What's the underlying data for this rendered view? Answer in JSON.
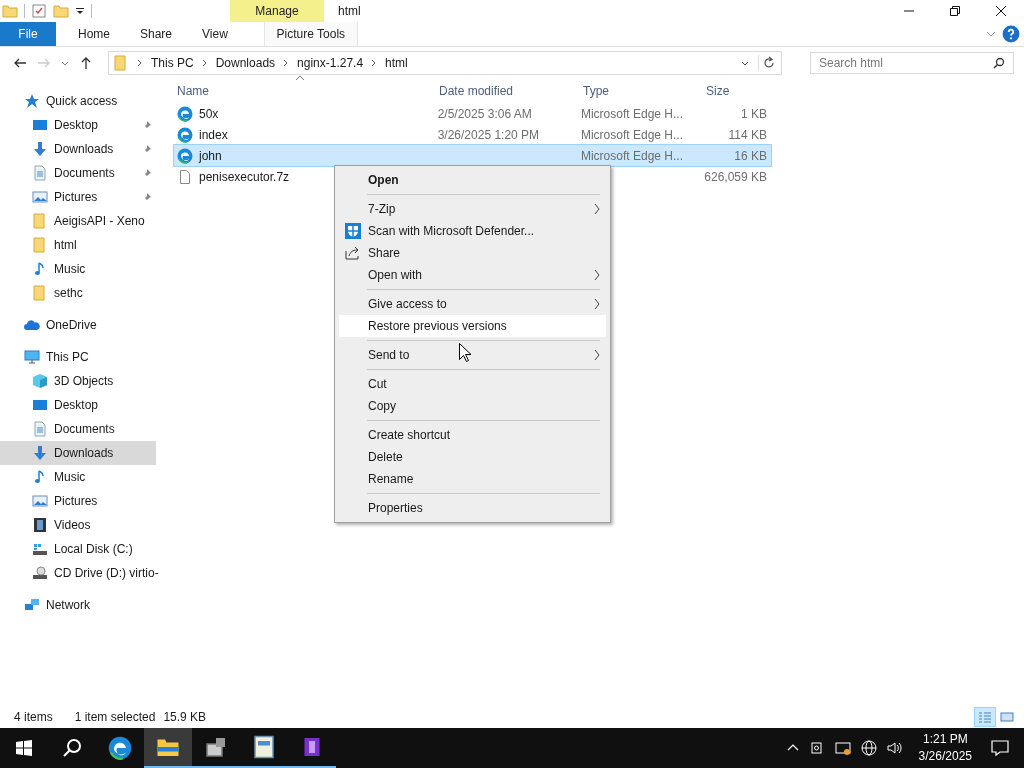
{
  "window": {
    "title": "html",
    "context_tab": "Manage"
  },
  "ribbon": {
    "tabs": [
      {
        "label": "File",
        "kind": "file",
        "selected": false
      },
      {
        "label": "Home",
        "kind": "tab",
        "selected": false
      },
      {
        "label": "Share",
        "kind": "tab",
        "selected": false
      },
      {
        "label": "View",
        "kind": "tab",
        "selected": false
      },
      {
        "label": "Picture Tools",
        "kind": "context",
        "selected": false
      }
    ]
  },
  "address": {
    "path": [
      "This PC",
      "Downloads",
      "nginx-1.27.4",
      "html"
    ],
    "forward_disabled": true
  },
  "search": {
    "placeholder": "Search html"
  },
  "nav": [
    {
      "label": "Quick access",
      "kind": "star",
      "selected": false,
      "children": [
        {
          "label": "Desktop",
          "kind": "desktop",
          "pinned": true,
          "selected": false
        },
        {
          "label": "Downloads",
          "kind": "downloads",
          "pinned": true,
          "selected": false
        },
        {
          "label": "Documents",
          "kind": "documents",
          "pinned": true,
          "selected": false
        },
        {
          "label": "Pictures",
          "kind": "pictures",
          "pinned": true,
          "selected": false
        },
        {
          "label": "AeigisAPI - Xeno",
          "kind": "folder",
          "pinned": false,
          "selected": false
        },
        {
          "label": "html",
          "kind": "folder",
          "pinned": false,
          "selected": false
        },
        {
          "label": "Music",
          "kind": "music",
          "pinned": false,
          "selected": false
        },
        {
          "label": "sethc",
          "kind": "folder",
          "pinned": false,
          "selected": false
        }
      ]
    },
    {
      "label": "OneDrive",
      "kind": "cloud",
      "selected": false
    },
    {
      "label": "This PC",
      "kind": "pc",
      "selected": false,
      "children": [
        {
          "label": "3D Objects",
          "kind": "objects",
          "selected": false
        },
        {
          "label": "Desktop",
          "kind": "desktop",
          "selected": false
        },
        {
          "label": "Documents",
          "kind": "documents",
          "selected": false
        },
        {
          "label": "Downloads",
          "kind": "downloads",
          "selected": true
        },
        {
          "label": "Music",
          "kind": "music",
          "selected": false
        },
        {
          "label": "Pictures",
          "kind": "pictures",
          "selected": false
        },
        {
          "label": "Videos",
          "kind": "videos",
          "selected": false
        },
        {
          "label": "Local Disk (C:)",
          "kind": "disk",
          "selected": false
        },
        {
          "label": "CD Drive (D:) virtio-",
          "kind": "cd",
          "selected": false
        }
      ]
    },
    {
      "label": "Network",
      "kind": "network",
      "selected": false
    }
  ],
  "table": {
    "columns": [
      "Name",
      "Date modified",
      "Type",
      "Size"
    ],
    "rows": [
      {
        "name": "50x",
        "kind": "edge",
        "date": "2/5/2025 3:06 AM",
        "type": "Microsoft Edge H...",
        "size": "1 KB",
        "selected": false
      },
      {
        "name": "index",
        "kind": "edge",
        "date": "3/26/2025 1:20 PM",
        "type": "Microsoft Edge H...",
        "size": "114 KB",
        "selected": false
      },
      {
        "name": "john",
        "kind": "edge",
        "type": "Microsoft Edge H...",
        "size": "16 KB",
        "selected": true
      },
      {
        "name": "penisexecutor.7z",
        "kind": "file",
        "size": "626,059 KB",
        "selected": false
      }
    ]
  },
  "context_menu": {
    "groups": [
      [
        {
          "label": "Open",
          "kind": "default",
          "submenu": false,
          "highlighted": false
        }
      ],
      [
        {
          "label": "7-Zip",
          "kind": "plain",
          "submenu": true,
          "highlighted": false
        },
        {
          "label": "Scan with Microsoft Defender...",
          "kind": "scan",
          "submenu": false,
          "highlighted": false
        },
        {
          "label": "Share",
          "kind": "share",
          "submenu": false,
          "highlighted": false
        },
        {
          "label": "Open with",
          "kind": "plain",
          "submenu": true,
          "highlighted": false
        }
      ],
      [
        {
          "label": "Give access to",
          "kind": "plain",
          "submenu": true,
          "highlighted": false
        },
        {
          "label": "Restore previous versions",
          "kind": "plain",
          "submenu": false,
          "highlighted": true
        }
      ],
      [
        {
          "label": "Send to",
          "kind": "plain",
          "submenu": true,
          "highlighted": false
        }
      ],
      [
        {
          "label": "Cut",
          "kind": "plain",
          "submenu": false,
          "highlighted": false
        },
        {
          "label": "Copy",
          "kind": "plain",
          "submenu": false,
          "highlighted": false
        }
      ],
      [
        {
          "label": "Create shortcut",
          "kind": "plain",
          "submenu": false,
          "highlighted": false
        },
        {
          "label": "Delete",
          "kind": "plain",
          "submenu": false,
          "highlighted": false
        },
        {
          "label": "Rename",
          "kind": "plain",
          "submenu": false,
          "highlighted": false
        }
      ],
      [
        {
          "label": "Properties",
          "kind": "plain",
          "submenu": false,
          "highlighted": false
        }
      ]
    ]
  },
  "status_bar": {
    "items": "4 items",
    "selection": "1 item selected",
    "size": "15.9 KB",
    "view_buttons": [
      {
        "kind": "details",
        "selected": true
      },
      {
        "kind": "icons",
        "selected": false
      }
    ]
  },
  "taskbar": {
    "apps": [
      {
        "kind": "edge",
        "active": false,
        "running": false
      },
      {
        "kind": "explorer",
        "active": true,
        "running": true
      },
      {
        "kind": "tool",
        "active": false,
        "running": true
      },
      {
        "kind": "document",
        "active": false,
        "running": true
      },
      {
        "kind": "purple",
        "active": false,
        "running": true
      }
    ],
    "time": "1:21 PM",
    "date": "3/26/2025"
  }
}
